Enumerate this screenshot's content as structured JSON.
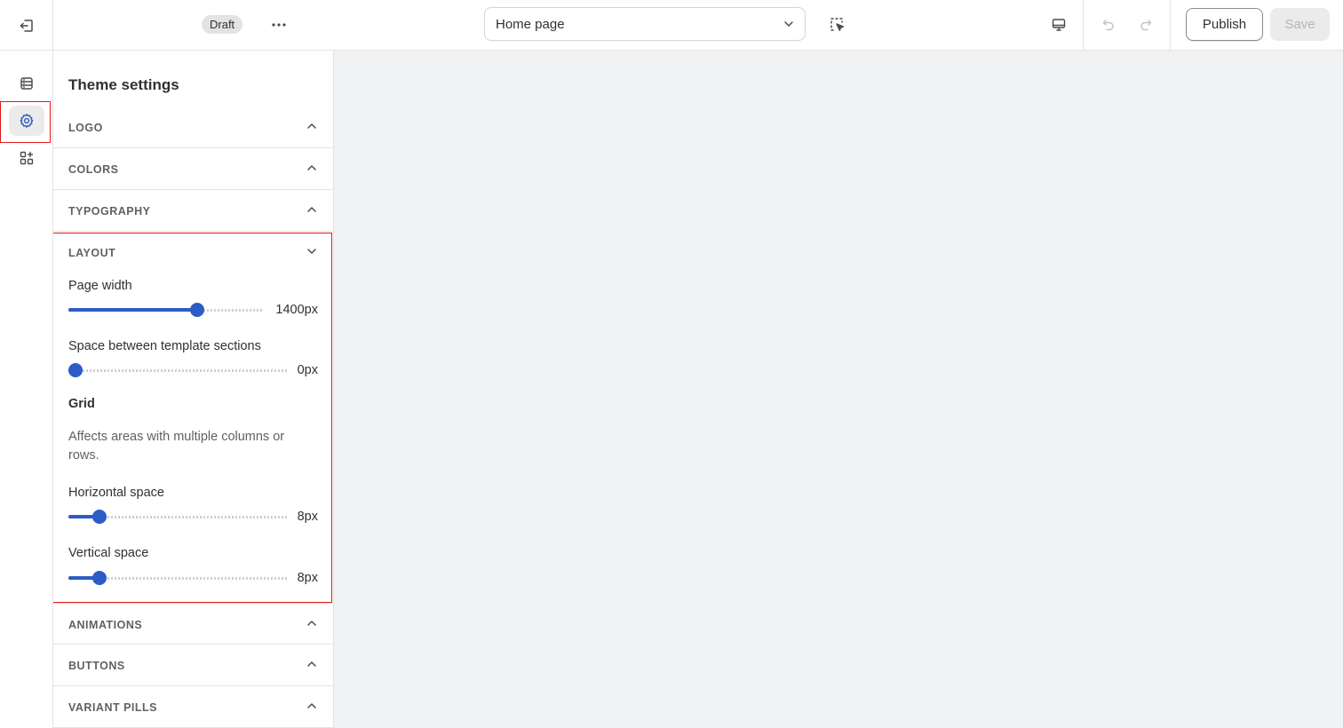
{
  "topbar": {
    "status_badge": "Draft",
    "page_select": "Home page",
    "publish_label": "Publish",
    "save_label": "Save"
  },
  "rail": {
    "items": [
      {
        "icon": "sections-icon",
        "active": false
      },
      {
        "icon": "gear-icon",
        "active": true
      },
      {
        "icon": "apps-icon",
        "active": false
      }
    ]
  },
  "panel": {
    "title": "Theme settings",
    "sections_top": [
      {
        "label": "LOGO"
      },
      {
        "label": "COLORS"
      },
      {
        "label": "TYPOGRAPHY"
      }
    ],
    "layout": {
      "label": "LAYOUT",
      "page_width": {
        "label": "Page width",
        "value": "1400px",
        "fraction": 0.66
      },
      "section_space": {
        "label": "Space between template sections",
        "value": "0px",
        "fraction": 0.0
      },
      "grid_heading": "Grid",
      "grid_help": "Affects areas with multiple columns or rows.",
      "horizontal_space": {
        "label": "Horizontal space",
        "value": "8px",
        "fraction": 0.14
      },
      "vertical_space": {
        "label": "Vertical space",
        "value": "8px",
        "fraction": 0.14
      }
    },
    "sections_bottom": [
      {
        "label": "ANIMATIONS"
      },
      {
        "label": "BUTTONS"
      },
      {
        "label": "VARIANT PILLS"
      }
    ]
  },
  "colors": {
    "accent": "#2c5cc5",
    "highlight": "#e01b1b",
    "canvas": "#f1f2f4"
  }
}
